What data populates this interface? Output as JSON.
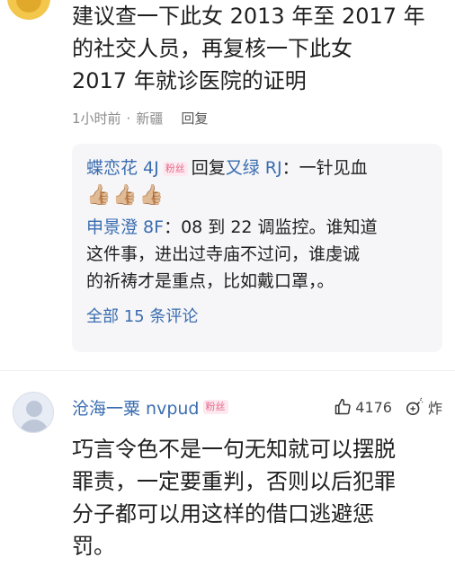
{
  "comment1": {
    "text_lines": [
      "建议查一下此女 2013 年至 2017 年",
      "的社交人员，再复核一下此女",
      "2017 年就诊医院的证明"
    ],
    "time": "1小时前",
    "dot": "·",
    "location": "新疆",
    "reply_label": "回复"
  },
  "replies": {
    "r1": {
      "user": "蝶恋花 4J",
      "badge": "粉丝",
      "reply_word": "回复",
      "target": "又绿 RJ",
      "text": "：一针见血",
      "emoji": "👍🏼👍🏼👍🏼"
    },
    "r2": {
      "user": "申景澄 8F",
      "text_first": "：08 到 22 调监控。谁知道",
      "text_line2": "这件事，进出过寺庙不过问，谁虔诚",
      "text_line3": "的祈祷才是重点，比如戴口罩，。"
    },
    "see_all": "全部 15 条评论"
  },
  "comment2": {
    "user": "沧海一粟 nvpud",
    "badge": "粉丝",
    "likes": "4176",
    "bomb_label": "炸",
    "text_lines": [
      "巧言令色不是一句无知就可以摆脱",
      "罪责，一定要重判，否则以后犯罪",
      "分子都可以用这样的借口逃避惩",
      "罚。"
    ]
  },
  "icons": {
    "like": "thumbs-up-outline-icon",
    "bomb": "bomb-icon",
    "avatar_top": "user-avatar",
    "avatar_default": "default-user-avatar"
  },
  "colors": {
    "link_blue": "#3b6db0",
    "meta_gray": "#8c8c8c",
    "badge_pink": "#e5688a",
    "reply_bg": "#f6f6f8"
  }
}
